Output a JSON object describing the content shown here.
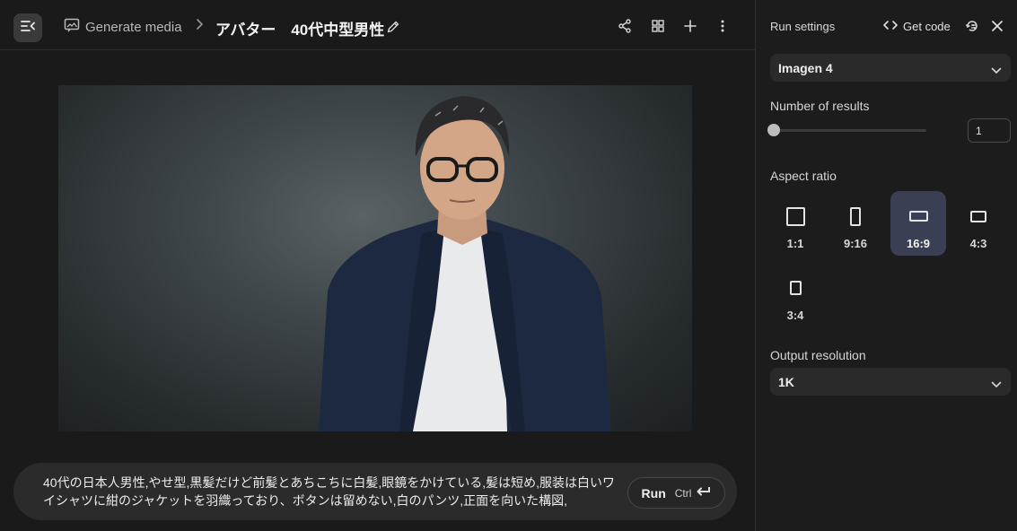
{
  "header": {
    "breadcrumb_root": "Generate media",
    "title": "アバター　40代中型男性"
  },
  "prompt": {
    "text": "40代の日本人男性,やせ型,黒髪だけど前髪とあちこちに白髪,眼鏡をかけている,髪は短め,服装は白いワイシャツに紺のジャケットを羽織っており、ボタンは留めない,白のパンツ,正面を向いた構図,",
    "run_label": "Run",
    "shortcut": "Ctrl"
  },
  "panel": {
    "title": "Run settings",
    "get_code": "Get code",
    "model": "Imagen 4",
    "results_label": "Number of results",
    "results_value": "1",
    "results_slider_fraction": 0,
    "aspect_label": "Aspect ratio",
    "aspect_ratios": [
      {
        "label": "1:1",
        "selected": false
      },
      {
        "label": "9:16",
        "selected": false
      },
      {
        "label": "16:9",
        "selected": true
      },
      {
        "label": "4:3",
        "selected": false
      },
      {
        "label": "3:4",
        "selected": false
      }
    ],
    "resolution_label": "Output resolution",
    "resolution": "1K"
  },
  "colors": {
    "accent_selected": "#3a3f53",
    "background": "#1a1a1a"
  },
  "icons": {
    "menu": "menu-collapse-icon",
    "media": "image-frame-icon",
    "edit": "pencil-icon",
    "share": "share-icon",
    "grid": "grid-icon",
    "add": "plus-icon",
    "more": "more-vert-icon",
    "code": "code-brackets-icon",
    "reset": "reset-settings-icon",
    "close": "close-icon"
  }
}
